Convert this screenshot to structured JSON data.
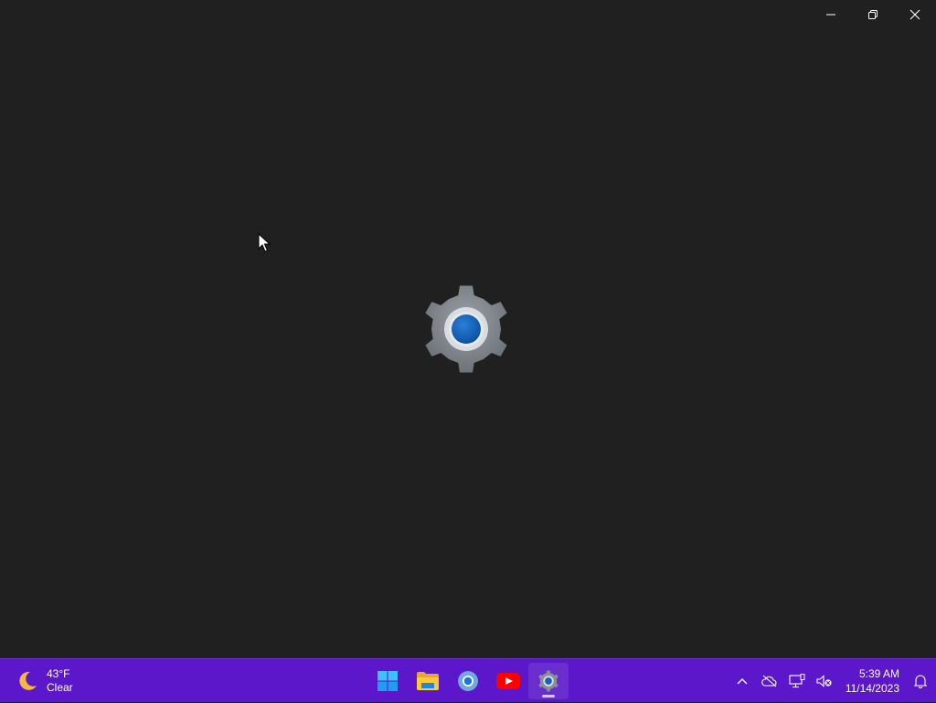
{
  "window": {
    "minimize_icon": "minimize-icon",
    "restore_icon": "restore-icon",
    "close_icon": "close-icon",
    "splash_icon": "settings-gear-icon"
  },
  "taskbar": {
    "background": "#5b17c9",
    "weather": {
      "temperature": "43°F",
      "condition": "Clear",
      "icon": "moon-icon"
    },
    "apps": [
      {
        "name": "Start",
        "icon": "windows-start-icon"
      },
      {
        "name": "File Explorer",
        "icon": "folder-icon"
      },
      {
        "name": "Chrome",
        "icon": "chrome-icon"
      },
      {
        "name": "YouTube",
        "icon": "youtube-icon"
      },
      {
        "name": "Settings",
        "icon": "settings-gear-icon",
        "active": true
      }
    ],
    "tray": {
      "icons": [
        "chevron-up-icon",
        "cloud-offline-icon",
        "network-icon",
        "volume-muted-icon",
        "bell-icon"
      ],
      "time": "5:39 AM",
      "date": "11/14/2023"
    }
  }
}
